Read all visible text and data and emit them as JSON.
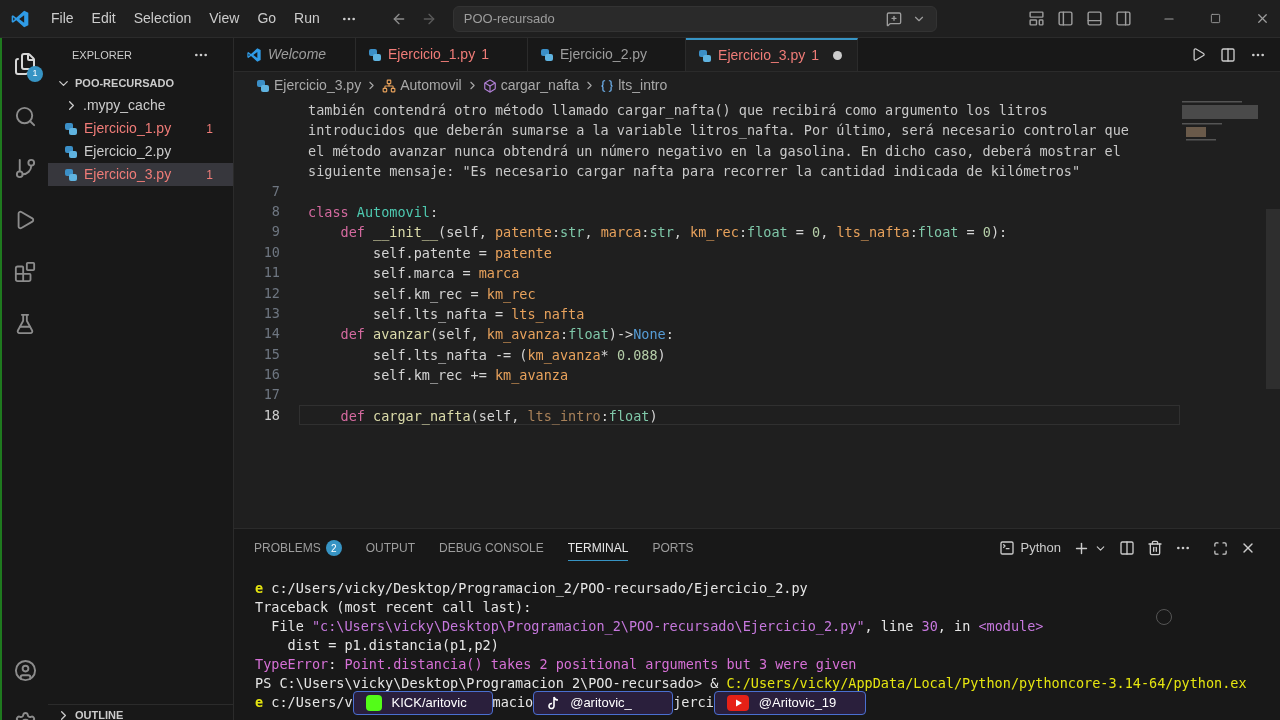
{
  "menu": [
    "File",
    "Edit",
    "Selection",
    "View",
    "Go",
    "Run"
  ],
  "command_center": "POO-recursado",
  "activity_bar": {
    "explorer_badge": "1"
  },
  "explorer": {
    "title": "EXPLORER",
    "folder": "POO-RECURSADO",
    "expanded": true,
    "items": [
      {
        "label": ".mypy_cache",
        "kind": "folder",
        "error": false,
        "selected": false
      },
      {
        "label": "Ejercicio_1.py",
        "kind": "python",
        "error": true,
        "badge": "1",
        "selected": false
      },
      {
        "label": "Ejercicio_2.py",
        "kind": "python",
        "error": false,
        "selected": false
      },
      {
        "label": "Ejercicio_3.py",
        "kind": "python",
        "error": true,
        "badge": "1",
        "selected": true
      }
    ],
    "outline": "OUTLINE"
  },
  "tabs": [
    {
      "label": "Welcome",
      "kind": "welcome",
      "error": false,
      "selected": false,
      "modified": false
    },
    {
      "label": "Ejercicio_1.py",
      "count": "1",
      "kind": "python",
      "error": true,
      "selected": false,
      "modified": false
    },
    {
      "label": "Ejercicio_2.py",
      "kind": "python",
      "error": false,
      "selected": false,
      "modified": false
    },
    {
      "label": "Ejercicio_3.py",
      "count": "1",
      "kind": "python",
      "error": true,
      "selected": true,
      "modified": true
    }
  ],
  "breadcrumbs": [
    {
      "label": "Ejercicio_3.py",
      "kind": "file"
    },
    {
      "label": "Automovil",
      "kind": "class"
    },
    {
      "label": "cargar_nafta",
      "kind": "method"
    },
    {
      "label": "lts_intro",
      "kind": "variable"
    }
  ],
  "editor": {
    "lines": [
      {
        "tokens": [
          {
            "text": "también contendrá otro método llamado cargar_nafta() que recibirá como argumento los litros",
            "kind": "doc"
          }
        ]
      },
      {
        "tokens": [
          {
            "text": "introducidos que deberán sumarse a la variable litros_nafta. Por último, será necesario controlar que",
            "kind": "doc"
          }
        ]
      },
      {
        "tokens": [
          {
            "text": "el método avanzar nunca obtendrá un número negativo en la gasolina. En dicho caso, deberá mostrar el",
            "kind": "doc"
          }
        ]
      },
      {
        "tokens": [
          {
            "text": "siguiente mensaje: \"Es necesario cargar nafta para recorrer la cantidad indicada de kilómetros\"",
            "kind": "doc"
          }
        ]
      },
      {
        "number": "7",
        "current": false
      },
      {
        "number": "8",
        "current": false,
        "tokens": [
          {
            "text": "class ",
            "kind": "kw"
          },
          {
            "text": "Automovil",
            "kind": "cls"
          },
          {
            "text": ":",
            "kind": "plain"
          }
        ]
      },
      {
        "number": "9",
        "current": false,
        "tokens": [
          {
            "text": "    def ",
            "kind": "kw"
          },
          {
            "text": "__init__",
            "kind": "fn"
          },
          {
            "text": "(self, ",
            "kind": "plain"
          },
          {
            "text": "patente",
            "kind": "param"
          },
          {
            "text": ":",
            "kind": "plain"
          },
          {
            "text": "str",
            "kind": "type"
          },
          {
            "text": ", ",
            "kind": "plain"
          },
          {
            "text": "marca",
            "kind": "param"
          },
          {
            "text": ":",
            "kind": "plain"
          },
          {
            "text": "str",
            "kind": "type"
          },
          {
            "text": ", ",
            "kind": "plain"
          },
          {
            "text": "km_rec",
            "kind": "param"
          },
          {
            "text": ":",
            "kind": "plain"
          },
          {
            "text": "float",
            "kind": "type"
          },
          {
            "text": " = ",
            "kind": "plain"
          },
          {
            "text": "0",
            "kind": "num"
          },
          {
            "text": ", ",
            "kind": "plain"
          },
          {
            "text": "lts_nafta",
            "kind": "param"
          },
          {
            "text": ":",
            "kind": "plain"
          },
          {
            "text": "float",
            "kind": "type"
          },
          {
            "text": " = ",
            "kind": "plain"
          },
          {
            "text": "0",
            "kind": "num"
          },
          {
            "text": "):",
            "kind": "plain"
          }
        ]
      },
      {
        "number": "10",
        "current": false,
        "tokens": [
          {
            "text": "        self.patente = ",
            "kind": "plain"
          },
          {
            "text": "patente",
            "kind": "param"
          }
        ]
      },
      {
        "number": "11",
        "current": false,
        "tokens": [
          {
            "text": "        self.marca = ",
            "kind": "plain"
          },
          {
            "text": "marca",
            "kind": "param"
          }
        ]
      },
      {
        "number": "12",
        "current": false,
        "tokens": [
          {
            "text": "        self.km_rec = ",
            "kind": "plain"
          },
          {
            "text": "km_rec",
            "kind": "param"
          }
        ]
      },
      {
        "number": "13",
        "current": false,
        "tokens": [
          {
            "text": "        self.lts_nafta = ",
            "kind": "plain"
          },
          {
            "text": "lts_nafta",
            "kind": "param"
          }
        ]
      },
      {
        "number": "14",
        "current": false,
        "tokens": [
          {
            "text": "    def ",
            "kind": "kw"
          },
          {
            "text": "avanzar",
            "kind": "fn"
          },
          {
            "text": "(self, ",
            "kind": "plain"
          },
          {
            "text": "km_avanza",
            "kind": "param"
          },
          {
            "text": ":",
            "kind": "plain"
          },
          {
            "text": "float",
            "kind": "type"
          },
          {
            "text": ")->",
            "kind": "plain"
          },
          {
            "text": "None",
            "kind": "const"
          },
          {
            "text": ":",
            "kind": "plain"
          }
        ]
      },
      {
        "number": "15",
        "current": false,
        "tokens": [
          {
            "text": "        self.lts_nafta -= (",
            "kind": "plain"
          },
          {
            "text": "km_avanza",
            "kind": "param"
          },
          {
            "text": "* ",
            "kind": "plain"
          },
          {
            "text": "0.088",
            "kind": "num"
          },
          {
            "text": ")",
            "kind": "plain"
          }
        ]
      },
      {
        "number": "16",
        "current": false,
        "tokens": [
          {
            "text": "        self.km_rec += ",
            "kind": "plain"
          },
          {
            "text": "km_avanza",
            "kind": "param"
          }
        ]
      },
      {
        "number": "17",
        "current": false
      },
      {
        "number": "18",
        "current": true,
        "tokens": [
          {
            "text": "    def ",
            "kind": "kw"
          },
          {
            "text": "cargar_nafta",
            "kind": "fn"
          },
          {
            "text": "(self, ",
            "kind": "plain"
          },
          {
            "text": "lts_intro",
            "kind": "unused"
          },
          {
            "text": ":",
            "kind": "plain"
          },
          {
            "text": "float",
            "kind": "type"
          },
          {
            "text": ")",
            "kind": "plain"
          }
        ]
      }
    ]
  },
  "panel": {
    "tabs": [
      {
        "label": "PROBLEMS",
        "badge": "2",
        "selected": false
      },
      {
        "label": "OUTPUT",
        "selected": false
      },
      {
        "label": "DEBUG CONSOLE",
        "selected": false
      },
      {
        "label": "TERMINAL",
        "selected": true
      },
      {
        "label": "PORTS",
        "selected": false
      }
    ],
    "shell": "Python",
    "lines": [
      {
        "tokens": [
          {
            "text": "e ",
            "kind": "prompt"
          },
          {
            "text": "c:/Users/vicky/Desktop/Programacion_2/POO-recursado/Ejercicio_2.py",
            "kind": "plain"
          }
        ]
      },
      {
        "tokens": [
          {
            "text": "Traceback (most recent call last):",
            "kind": "plain"
          }
        ]
      },
      {
        "tokens": [
          {
            "text": "  File ",
            "kind": "plain"
          },
          {
            "text": "\"c:\\Users\\vicky\\Desktop\\Programacion_2\\POO-recursado\\Ejercicio_2.py\"",
            "kind": "string"
          },
          {
            "text": ", line ",
            "kind": "plain"
          },
          {
            "text": "30",
            "kind": "string"
          },
          {
            "text": ", in ",
            "kind": "plain"
          },
          {
            "text": "<module>",
            "kind": "string"
          }
        ]
      },
      {
        "tokens": [
          {
            "text": "    dist = p1.distancia(p1,p2)",
            "kind": "plain"
          }
        ]
      },
      {
        "tokens": [
          {
            "text": "TypeError",
            "kind": "error"
          },
          {
            "text": ": ",
            "kind": "plain"
          },
          {
            "text": "Point.distancia() takes 2 positional arguments but 3 were given",
            "kind": "error"
          }
        ]
      },
      {
        "tokens": [
          {
            "text": "PS C:\\Users\\vicky\\Desktop\\Programacion_2\\POO-recursado> & ",
            "kind": "plain"
          },
          {
            "text": "C:/Users/vicky/AppData/Local/Python/pythoncore-3.14-64/python.ex",
            "kind": "path"
          }
        ]
      }
    ],
    "last_line": [
      {
        "text": "e ",
        "kind": "prompt"
      },
      {
        "text": "c:/Users/v",
        "kind": "plain"
      },
      {
        "text": "KICK/aritovic",
        "kind": "kick"
      },
      {
        "text": "macio",
        "kind": "plain"
      },
      {
        "text": "@aritovic_",
        "kind": "tiktok"
      },
      {
        "text": "jerci",
        "kind": "plain"
      },
      {
        "text": "@Aritovic_19",
        "kind": "youtube"
      }
    ]
  }
}
